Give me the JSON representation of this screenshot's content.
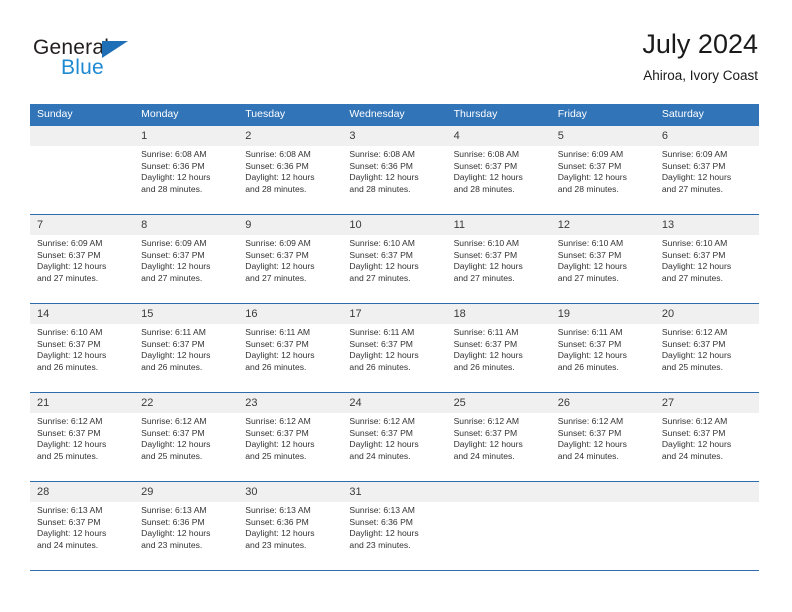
{
  "brand": {
    "name_top": "General",
    "name_bottom": "Blue",
    "color_dark": "#231f20",
    "color_blue": "#1f8ad2",
    "triangle_color": "#1f6fb6"
  },
  "header": {
    "title": "July 2024",
    "subtitle": "Ahiroa, Ivory Coast"
  },
  "theme": {
    "header_row_bg": "#3274b8",
    "week_divider": "#2d6cad",
    "date_band_bg": "#f0f0f0"
  },
  "weekdays": [
    "Sunday",
    "Monday",
    "Tuesday",
    "Wednesday",
    "Thursday",
    "Friday",
    "Saturday"
  ],
  "weeks": [
    {
      "days": [
        {
          "num": "",
          "sunrise": "",
          "sunset": "",
          "daylight1": "",
          "daylight2": ""
        },
        {
          "num": "1",
          "sunrise": "Sunrise: 6:08 AM",
          "sunset": "Sunset: 6:36 PM",
          "daylight1": "Daylight: 12 hours",
          "daylight2": "and 28 minutes."
        },
        {
          "num": "2",
          "sunrise": "Sunrise: 6:08 AM",
          "sunset": "Sunset: 6:36 PM",
          "daylight1": "Daylight: 12 hours",
          "daylight2": "and 28 minutes."
        },
        {
          "num": "3",
          "sunrise": "Sunrise: 6:08 AM",
          "sunset": "Sunset: 6:36 PM",
          "daylight1": "Daylight: 12 hours",
          "daylight2": "and 28 minutes."
        },
        {
          "num": "4",
          "sunrise": "Sunrise: 6:08 AM",
          "sunset": "Sunset: 6:37 PM",
          "daylight1": "Daylight: 12 hours",
          "daylight2": "and 28 minutes."
        },
        {
          "num": "5",
          "sunrise": "Sunrise: 6:09 AM",
          "sunset": "Sunset: 6:37 PM",
          "daylight1": "Daylight: 12 hours",
          "daylight2": "and 28 minutes."
        },
        {
          "num": "6",
          "sunrise": "Sunrise: 6:09 AM",
          "sunset": "Sunset: 6:37 PM",
          "daylight1": "Daylight: 12 hours",
          "daylight2": "and 27 minutes."
        }
      ]
    },
    {
      "days": [
        {
          "num": "7",
          "sunrise": "Sunrise: 6:09 AM",
          "sunset": "Sunset: 6:37 PM",
          "daylight1": "Daylight: 12 hours",
          "daylight2": "and 27 minutes."
        },
        {
          "num": "8",
          "sunrise": "Sunrise: 6:09 AM",
          "sunset": "Sunset: 6:37 PM",
          "daylight1": "Daylight: 12 hours",
          "daylight2": "and 27 minutes."
        },
        {
          "num": "9",
          "sunrise": "Sunrise: 6:09 AM",
          "sunset": "Sunset: 6:37 PM",
          "daylight1": "Daylight: 12 hours",
          "daylight2": "and 27 minutes."
        },
        {
          "num": "10",
          "sunrise": "Sunrise: 6:10 AM",
          "sunset": "Sunset: 6:37 PM",
          "daylight1": "Daylight: 12 hours",
          "daylight2": "and 27 minutes."
        },
        {
          "num": "11",
          "sunrise": "Sunrise: 6:10 AM",
          "sunset": "Sunset: 6:37 PM",
          "daylight1": "Daylight: 12 hours",
          "daylight2": "and 27 minutes."
        },
        {
          "num": "12",
          "sunrise": "Sunrise: 6:10 AM",
          "sunset": "Sunset: 6:37 PM",
          "daylight1": "Daylight: 12 hours",
          "daylight2": "and 27 minutes."
        },
        {
          "num": "13",
          "sunrise": "Sunrise: 6:10 AM",
          "sunset": "Sunset: 6:37 PM",
          "daylight1": "Daylight: 12 hours",
          "daylight2": "and 27 minutes."
        }
      ]
    },
    {
      "days": [
        {
          "num": "14",
          "sunrise": "Sunrise: 6:10 AM",
          "sunset": "Sunset: 6:37 PM",
          "daylight1": "Daylight: 12 hours",
          "daylight2": "and 26 minutes."
        },
        {
          "num": "15",
          "sunrise": "Sunrise: 6:11 AM",
          "sunset": "Sunset: 6:37 PM",
          "daylight1": "Daylight: 12 hours",
          "daylight2": "and 26 minutes."
        },
        {
          "num": "16",
          "sunrise": "Sunrise: 6:11 AM",
          "sunset": "Sunset: 6:37 PM",
          "daylight1": "Daylight: 12 hours",
          "daylight2": "and 26 minutes."
        },
        {
          "num": "17",
          "sunrise": "Sunrise: 6:11 AM",
          "sunset": "Sunset: 6:37 PM",
          "daylight1": "Daylight: 12 hours",
          "daylight2": "and 26 minutes."
        },
        {
          "num": "18",
          "sunrise": "Sunrise: 6:11 AM",
          "sunset": "Sunset: 6:37 PM",
          "daylight1": "Daylight: 12 hours",
          "daylight2": "and 26 minutes."
        },
        {
          "num": "19",
          "sunrise": "Sunrise: 6:11 AM",
          "sunset": "Sunset: 6:37 PM",
          "daylight1": "Daylight: 12 hours",
          "daylight2": "and 26 minutes."
        },
        {
          "num": "20",
          "sunrise": "Sunrise: 6:12 AM",
          "sunset": "Sunset: 6:37 PM",
          "daylight1": "Daylight: 12 hours",
          "daylight2": "and 25 minutes."
        }
      ]
    },
    {
      "days": [
        {
          "num": "21",
          "sunrise": "Sunrise: 6:12 AM",
          "sunset": "Sunset: 6:37 PM",
          "daylight1": "Daylight: 12 hours",
          "daylight2": "and 25 minutes."
        },
        {
          "num": "22",
          "sunrise": "Sunrise: 6:12 AM",
          "sunset": "Sunset: 6:37 PM",
          "daylight1": "Daylight: 12 hours",
          "daylight2": "and 25 minutes."
        },
        {
          "num": "23",
          "sunrise": "Sunrise: 6:12 AM",
          "sunset": "Sunset: 6:37 PM",
          "daylight1": "Daylight: 12 hours",
          "daylight2": "and 25 minutes."
        },
        {
          "num": "24",
          "sunrise": "Sunrise: 6:12 AM",
          "sunset": "Sunset: 6:37 PM",
          "daylight1": "Daylight: 12 hours",
          "daylight2": "and 24 minutes."
        },
        {
          "num": "25",
          "sunrise": "Sunrise: 6:12 AM",
          "sunset": "Sunset: 6:37 PM",
          "daylight1": "Daylight: 12 hours",
          "daylight2": "and 24 minutes."
        },
        {
          "num": "26",
          "sunrise": "Sunrise: 6:12 AM",
          "sunset": "Sunset: 6:37 PM",
          "daylight1": "Daylight: 12 hours",
          "daylight2": "and 24 minutes."
        },
        {
          "num": "27",
          "sunrise": "Sunrise: 6:12 AM",
          "sunset": "Sunset: 6:37 PM",
          "daylight1": "Daylight: 12 hours",
          "daylight2": "and 24 minutes."
        }
      ]
    },
    {
      "days": [
        {
          "num": "28",
          "sunrise": "Sunrise: 6:13 AM",
          "sunset": "Sunset: 6:37 PM",
          "daylight1": "Daylight: 12 hours",
          "daylight2": "and 24 minutes."
        },
        {
          "num": "29",
          "sunrise": "Sunrise: 6:13 AM",
          "sunset": "Sunset: 6:36 PM",
          "daylight1": "Daylight: 12 hours",
          "daylight2": "and 23 minutes."
        },
        {
          "num": "30",
          "sunrise": "Sunrise: 6:13 AM",
          "sunset": "Sunset: 6:36 PM",
          "daylight1": "Daylight: 12 hours",
          "daylight2": "and 23 minutes."
        },
        {
          "num": "31",
          "sunrise": "Sunrise: 6:13 AM",
          "sunset": "Sunset: 6:36 PM",
          "daylight1": "Daylight: 12 hours",
          "daylight2": "and 23 minutes."
        },
        {
          "num": "",
          "sunrise": "",
          "sunset": "",
          "daylight1": "",
          "daylight2": ""
        },
        {
          "num": "",
          "sunrise": "",
          "sunset": "",
          "daylight1": "",
          "daylight2": ""
        },
        {
          "num": "",
          "sunrise": "",
          "sunset": "",
          "daylight1": "",
          "daylight2": ""
        }
      ]
    }
  ]
}
